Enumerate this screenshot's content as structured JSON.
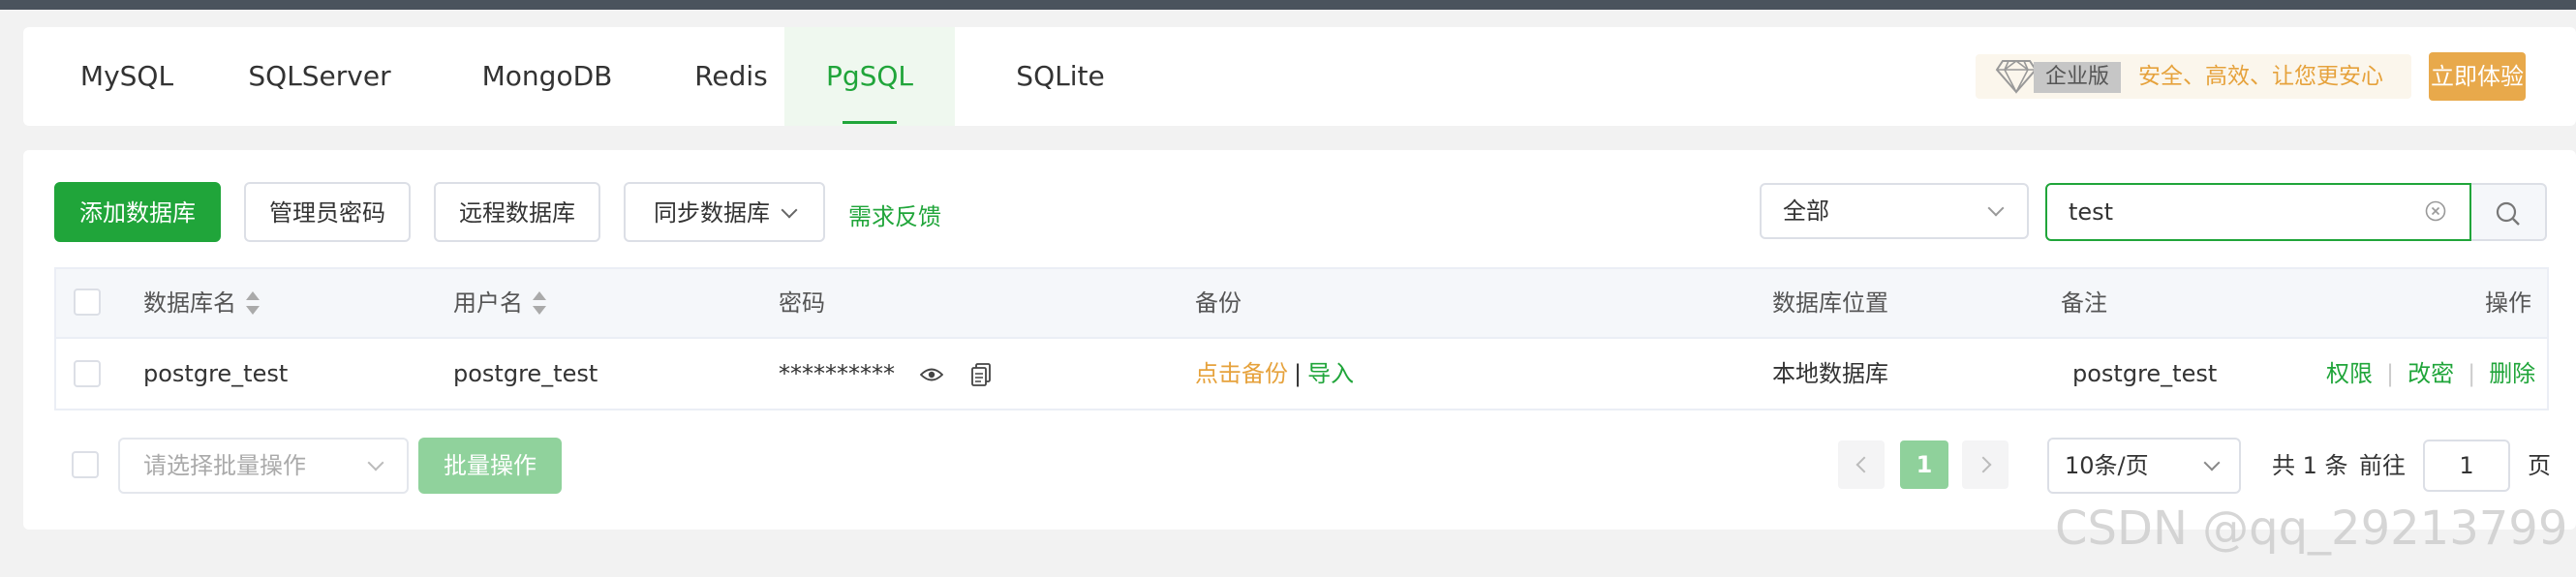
{
  "tabs": [
    {
      "label": "MySQL",
      "active": false
    },
    {
      "label": "SQLServer",
      "active": false
    },
    {
      "label": "MongoDB",
      "active": false
    },
    {
      "label": "Redis",
      "active": false
    },
    {
      "label": "PgSQL",
      "active": true
    },
    {
      "label": "SQLite",
      "active": false
    }
  ],
  "promo": {
    "edition": "企业版",
    "slogan": "安全、高效、让您更安心",
    "cta": "立即体验"
  },
  "toolbar": {
    "add_db": "添加数据库",
    "admin_password": "管理员密码",
    "remote_db": "远程数据库",
    "sync_db": "同步数据库",
    "feedback": "需求反馈"
  },
  "filter": {
    "selected": "全部",
    "search_value": "test"
  },
  "table": {
    "headers": {
      "db_name": "数据库名",
      "username": "用户名",
      "password": "密码",
      "backup": "备份",
      "location": "数据库位置",
      "remark": "备注",
      "actions": "操作"
    },
    "rows": [
      {
        "db_name": "postgre_test",
        "username": "postgre_test",
        "password": "**********",
        "backup_action": "点击备份",
        "import_action": "导入",
        "location": "本地数据库",
        "remark": "postgre_test",
        "act_perm": "权限",
        "act_pwd": "改密",
        "act_delete": "删除"
      }
    ]
  },
  "footer": {
    "batch_placeholder": "请选择批量操作",
    "batch_button": "批量操作",
    "current_page": "1",
    "page_size": "10条/页",
    "total": "共 1 条",
    "goto_label": "前往",
    "goto_value": "1",
    "page_unit": "页"
  },
  "watermark": "CSDN @qq_29213799",
  "colors": {
    "accent": "#20a53a",
    "warning": "#e6a23c",
    "topbar": "#4a535d"
  }
}
